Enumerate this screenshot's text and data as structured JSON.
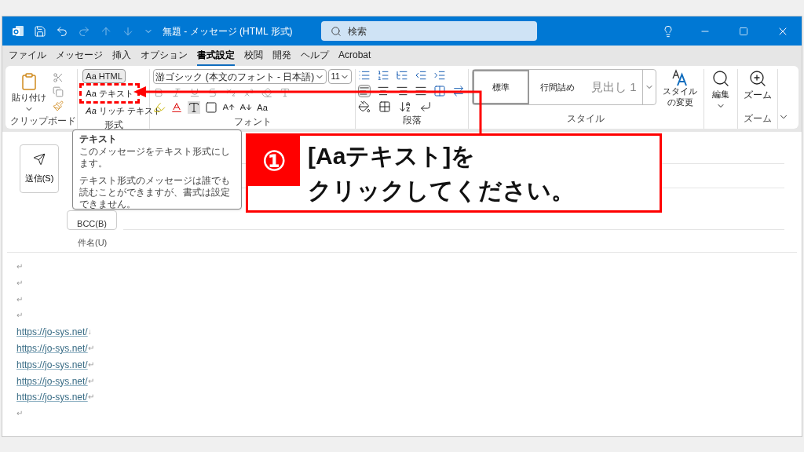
{
  "title_bar": {
    "title": "無題 - メッセージ (HTML 形式)",
    "search_placeholder": "検索"
  },
  "menu_tabs": [
    {
      "label": "ファイル",
      "selected": false
    },
    {
      "label": "メッセージ",
      "selected": false
    },
    {
      "label": "挿入",
      "selected": false
    },
    {
      "label": "オプション",
      "selected": false
    },
    {
      "label": "書式設定",
      "selected": true
    },
    {
      "label": "校閲",
      "selected": false
    },
    {
      "label": "開発",
      "selected": false
    },
    {
      "label": "ヘルプ",
      "selected": false
    },
    {
      "label": "Acrobat",
      "selected": false
    }
  ],
  "ribbon": {
    "clipboard": {
      "paste": "貼り付け",
      "label": "クリップボード"
    },
    "format": {
      "label": "形式",
      "options": [
        {
          "text": "Aa HTML",
          "selected": true
        },
        {
          "text": "Aa テキスト",
          "selected": false
        },
        {
          "text": "*Aa* リッチ テキスト",
          "selected": false
        }
      ]
    },
    "font": {
      "font_name": "游ゴシック (本文のフォント - 日本語)",
      "font_size": "11",
      "change_case": "Aa",
      "label": "フォント"
    },
    "paragraph": {
      "label": "段落"
    },
    "styles": {
      "items": [
        {
          "text": "標準",
          "selected": true
        },
        {
          "text": "行間詰め",
          "selected": false
        },
        {
          "text": "見出し 1",
          "selected": false
        }
      ],
      "change_styles": "スタイルの変更",
      "label": "スタイル"
    },
    "editing": {
      "text": "編集"
    },
    "zoom": {
      "button": "ズーム",
      "label": "ズーム"
    }
  },
  "compose": {
    "send": "送信(S)",
    "bcc": "BCC(B)",
    "subject_label": "件名(U)"
  },
  "tooltip": {
    "title": "テキスト",
    "paragraphs": [
      "このメッセージをテキスト形式にします。",
      "テキスト形式のメッセージは誰でも読むことができますが、書式は設定できません。"
    ]
  },
  "body_lines": [
    {
      "kind": "empty",
      "mark": "↵"
    },
    {
      "kind": "empty",
      "mark": "↵"
    },
    {
      "kind": "empty",
      "mark": "↵"
    },
    {
      "kind": "empty",
      "mark": "↵"
    },
    {
      "kind": "link",
      "text": "https://jo-sys.net/",
      "mark": "↓"
    },
    {
      "kind": "link",
      "text": "https://jo-sys.net/",
      "mark": "↵"
    },
    {
      "kind": "link",
      "text": "https://jo-sys.net/",
      "mark": "↵"
    },
    {
      "kind": "link",
      "text": "https://jo-sys.net/",
      "mark": "↵"
    },
    {
      "kind": "link",
      "text": "https://jo-sys.net/",
      "mark": "↵"
    },
    {
      "kind": "empty",
      "mark": "↵"
    }
  ],
  "callout": {
    "number": "①",
    "lines": [
      "[Aaテキスト]を",
      "クリックしてください。"
    ]
  }
}
